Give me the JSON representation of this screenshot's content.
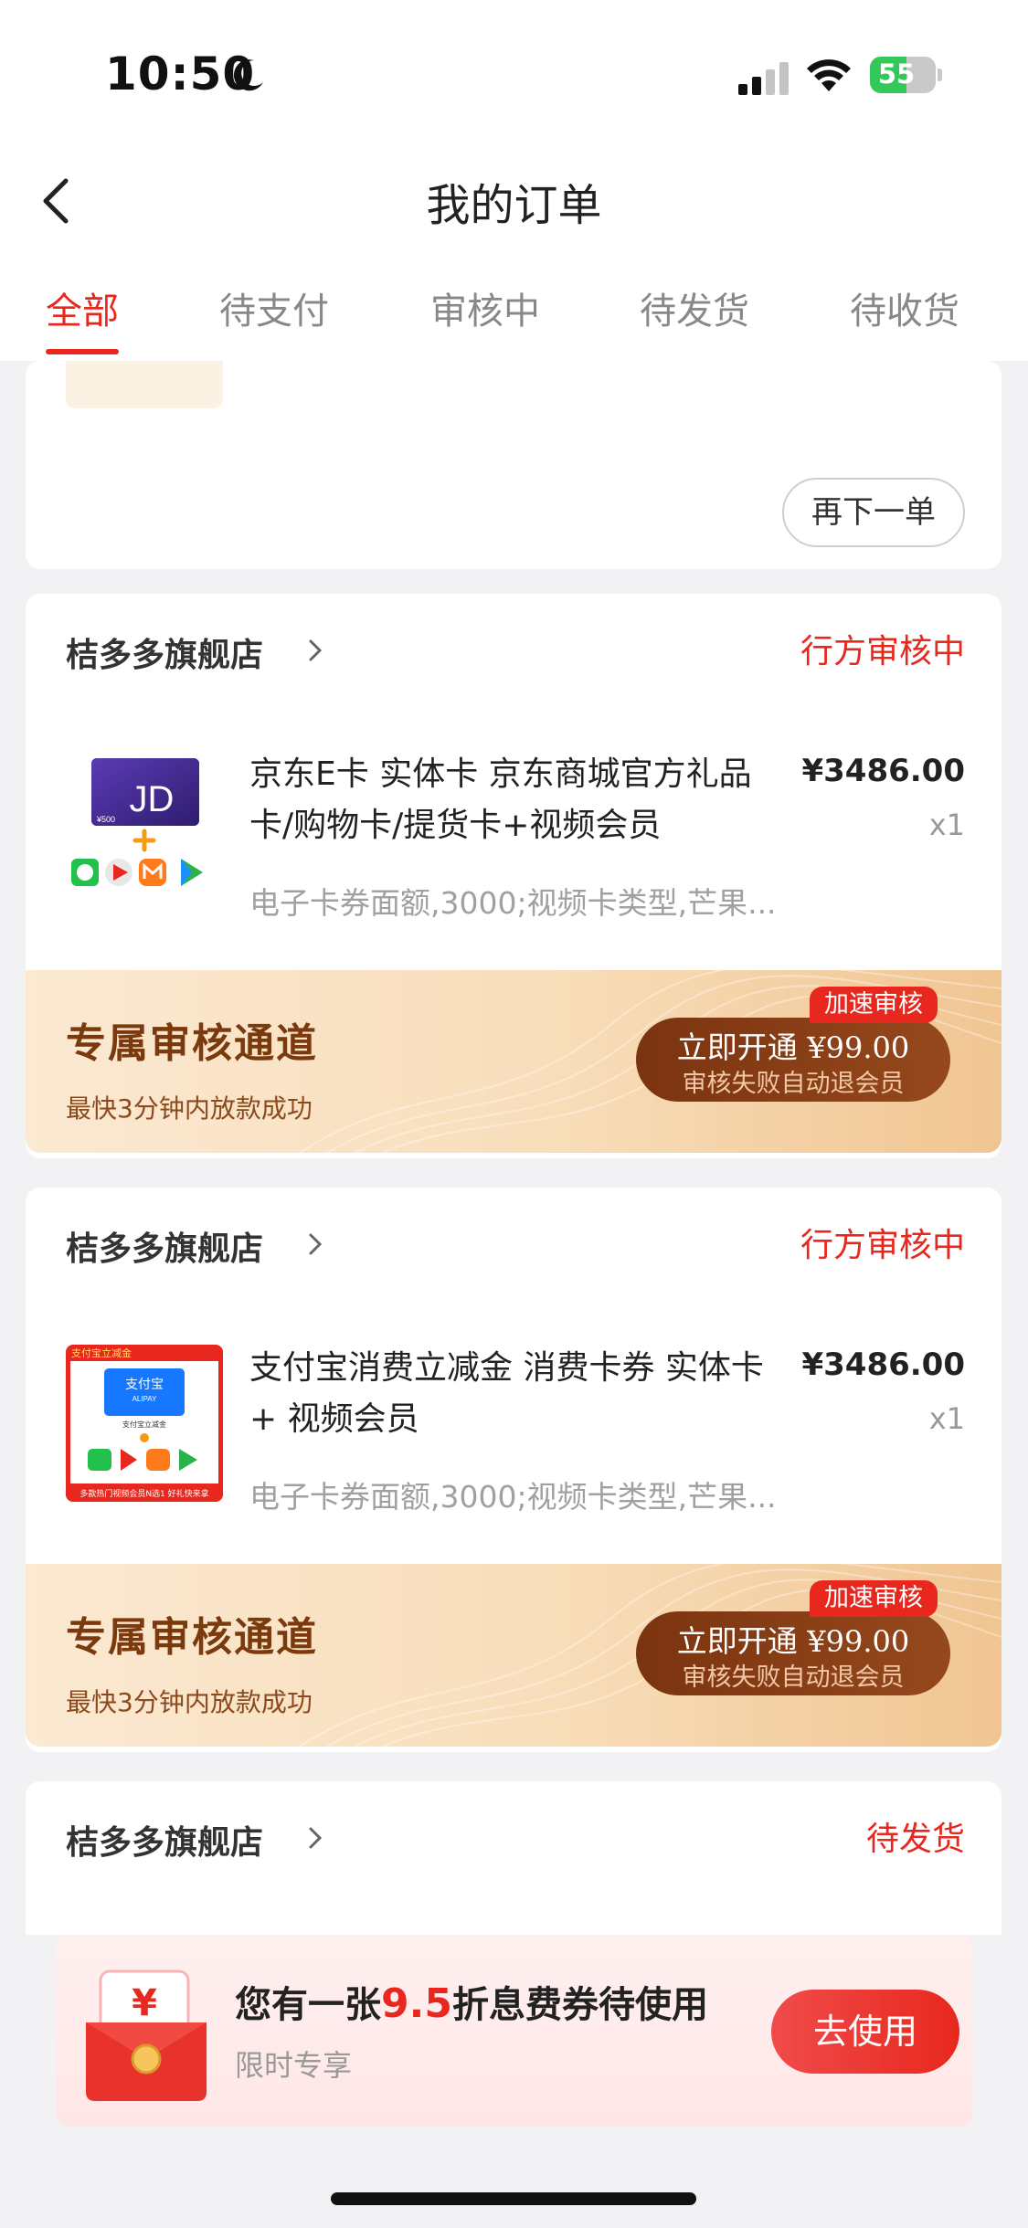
{
  "status_bar": {
    "time": "10:50",
    "battery_level": "55",
    "icons": [
      "moon-icon",
      "cellular-signal-icon",
      "wifi-icon",
      "battery-icon"
    ]
  },
  "nav": {
    "title": "我的订单",
    "back_icon": "chevron-left-icon"
  },
  "tabs": [
    {
      "label": "全部",
      "active": true
    },
    {
      "label": "待支付",
      "active": false
    },
    {
      "label": "审核中",
      "active": false
    },
    {
      "label": "待发货",
      "active": false
    },
    {
      "label": "待收货",
      "active": false
    }
  ],
  "orders": [
    {
      "reorder_label": "再下一单"
    },
    {
      "store": "桔多多旗舰店",
      "status": "行方审核中",
      "title": "京东E卡 实体卡 京东商城官方礼品卡/购物卡/提货卡+视频会员",
      "price": "¥3486.00",
      "qty": "x1",
      "spec": "电子卡券面额,3000;视频卡类型,芒果...",
      "image_text": {
        "card_logo": "JD",
        "card_value": "¥500"
      },
      "promo": {
        "title": "专属审核通道",
        "subtitle": "最快3分钟内放款成功",
        "button_main": "立即开通",
        "button_price": "¥99.00",
        "button_sub": "审核失败自动退会员",
        "badge": "加速审核"
      }
    },
    {
      "store": "桔多多旗舰店",
      "status": "行方审核中",
      "title": "支付宝消费立减金 消费卡券 实体卡 + 视频会员",
      "price": "¥3486.00",
      "qty": "x1",
      "spec": "电子卡券面额,3000;视频卡类型,芒果...",
      "image_text": {
        "corner": "支付宝立减金",
        "card_logo": "支付宝",
        "card_sub": "ALIPAY",
        "card_caption": "支付宝立减金",
        "footer": "多款热门视频会员N选1 好礼快来拿"
      },
      "promo": {
        "title": "专属审核通道",
        "subtitle": "最快3分钟内放款成功",
        "button_main": "立即开通",
        "button_price": "¥99.00",
        "button_sub": "审核失败自动退会员",
        "badge": "加速审核"
      }
    },
    {
      "store": "桔多多旗舰店",
      "status": "待发货"
    }
  ],
  "coupon": {
    "title_prefix": "您有一张",
    "title_highlight": "9.5",
    "title_suffix": "折息费券待使用",
    "subtitle": "限时专享",
    "button": "去使用",
    "icon": "red-envelope-yuan-icon",
    "icon_glyph": "¥"
  },
  "colors": {
    "accent_red": "#e8281e",
    "promo_brown": "#7a3a0e",
    "promo_gold": "#f0c592"
  }
}
